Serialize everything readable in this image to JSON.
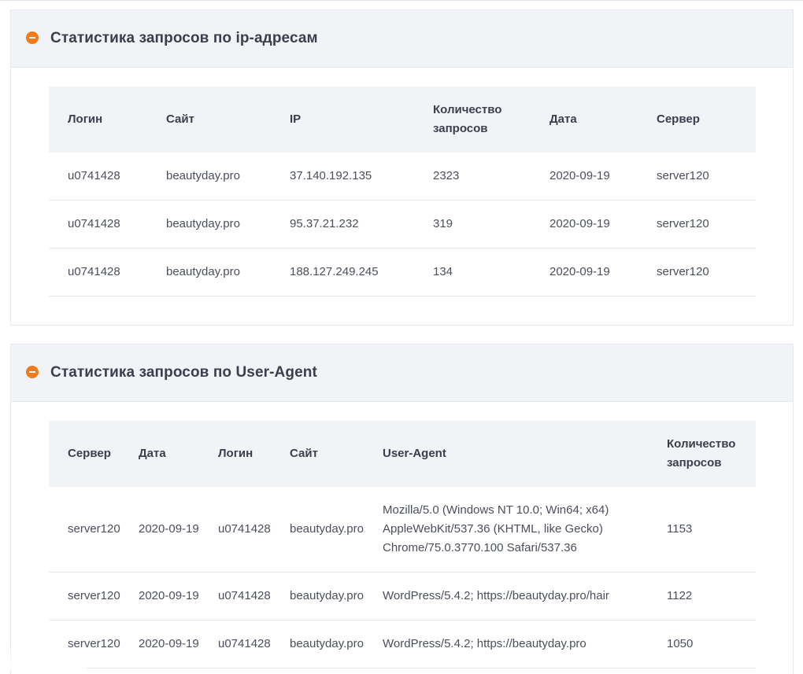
{
  "ip_stats": {
    "title": "Статистика запросов по ip-адресам",
    "columns": [
      "Логин",
      "Сайт",
      "IP",
      "Количество запросов",
      "Дата",
      "Сервер"
    ],
    "rows": [
      [
        "u0741428",
        "beautyday.pro",
        "37.140.192.135",
        "2323",
        "2020-09-19",
        "server120"
      ],
      [
        "u0741428",
        "beautyday.pro",
        "95.37.21.232",
        "319",
        "2020-09-19",
        "server120"
      ],
      [
        "u0741428",
        "beautyday.pro",
        "188.127.249.245",
        "134",
        "2020-09-19",
        "server120"
      ]
    ]
  },
  "ua_stats": {
    "title": "Статистика запросов по User-Agent",
    "columns": [
      "Сервер",
      "Дата",
      "Логин",
      "Сайт",
      "User-Agent",
      "Количество запросов"
    ],
    "rows": [
      [
        "server120",
        "2020-09-19",
        "u0741428",
        "beautyday.pro",
        "Mozilla/5.0 (Windows NT 10.0; Win64; x64) AppleWebKit/537.36 (KHTML, like Gecko) Chrome/75.0.3770.100 Safari/537.36",
        "1153"
      ],
      [
        "server120",
        "2020-09-19",
        "u0741428",
        "beautyday.pro",
        "WordPress/5.4.2; https://beautyday.pro/hair",
        "1122"
      ],
      [
        "server120",
        "2020-09-19",
        "u0741428",
        "beautyday.pro",
        "WordPress/5.4.2; https://beautyday.pro",
        "1050"
      ]
    ]
  },
  "colors": {
    "accent": "#f07a1c",
    "header_bg": "#f2f3f7",
    "border": "#e6e9ef"
  },
  "icons": {
    "collapse": "minus-circle-icon"
  }
}
